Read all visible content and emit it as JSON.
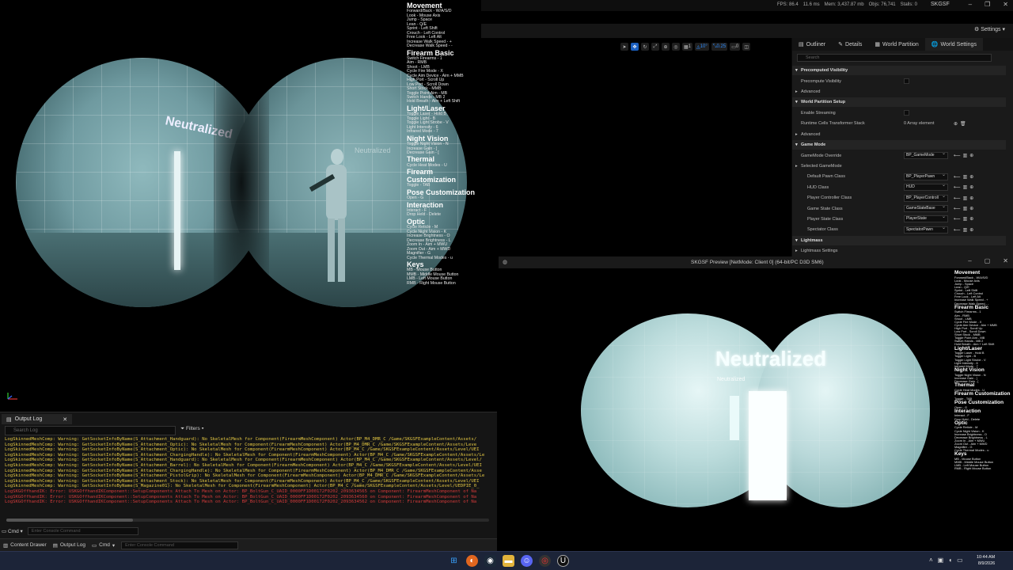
{
  "controls": {
    "sections": [
      {
        "title": "Movement",
        "items": [
          "Forward/Back - W/A/S/D",
          "Look - Mouse Axis",
          "Jump - Space",
          "Lean - Q/E",
          "Sprint - Left Shift",
          "Crouch - Left Control",
          "Free Look - Left Alt",
          "Increase Walk Speed - +",
          "Decrease Walk Speed - -"
        ]
      },
      {
        "title": "Firearm Basic",
        "items": [
          "Switch Firearms - 1",
          "Aim - RMB",
          "Shoot - LMB",
          "Cycle Fire Mode - X",
          "Cycle Aim Device - Aim + MMB",
          "High Port - Scroll Up",
          "Low Port - Scroll Down",
          "Short Stock - MMB",
          "Toggle Point Aim - MB",
          "Switch Hands - MB 2",
          "Hold Breath - Aim + Left Shift"
        ]
      },
      {
        "title": "Light/Laser",
        "items": [
          "Toggle Laser - Hold B",
          "Toggle Light - B",
          "Toggle Light Strobe - V",
          "Light Intensity - 6",
          "Infrared Mode - 7"
        ]
      },
      {
        "title": "Night Vision",
        "items": [
          "Toggle Night Vision - N",
          "Increase Gain - ]",
          "Decrease Gain - ["
        ]
      },
      {
        "title": "Thermal",
        "items": [
          "Cycle Heat Modes - U"
        ]
      },
      {
        "title": "Firearm Customization",
        "items": [
          "Toggle - TAB"
        ]
      },
      {
        "title": "Pose Customization",
        "items": [
          "Open - G"
        ]
      },
      {
        "title": "Interaction",
        "items": [
          "Interact - F",
          "Drop Held - Delete"
        ]
      },
      {
        "title": "Optic",
        "items": [
          "Cycle Reticle - M",
          "Cycle Night Vision - K",
          "Increase Brightness - O",
          "Decrease Brightness - L",
          "Zoom In - Aim + MWU",
          "Zoom Out - Aim + MWD",
          "Magnifier - G",
          "Cycle Thermal Modes - u"
        ]
      },
      {
        "title": "Keys",
        "items": [
          "MB - Mouse Button",
          "MMB - Middle Mouse Button",
          "LMB - Left Mouse Button",
          "RMB - Right Mouse Button"
        ]
      }
    ]
  },
  "game_left": {
    "target_label": "Neutralized",
    "faint_label": "Neutralized"
  },
  "top_bar": {
    "stats": [
      "FPS: 86.4",
      "11.6 ms",
      "Mem: 3,437.87 mb",
      "Objs: 76,741",
      "Stalls: 0"
    ],
    "title": "SKGSF",
    "settings_label": "Settings"
  },
  "viewport_toolbar": {
    "snap_angle": "10°",
    "camera_speed": "0.25",
    "grid": "1",
    "layers": "0"
  },
  "details": {
    "tabs": [
      "Outliner",
      "Details",
      "World Partition",
      "World Settings"
    ],
    "search_placeholder": "Search",
    "rows": [
      {
        "kind": "cat",
        "label": "Precomputed Visibility"
      },
      {
        "kind": "prop",
        "label": "Precompute Visibility",
        "control": "checkbox"
      },
      {
        "kind": "sub",
        "label": "Advanced"
      },
      {
        "kind": "cat",
        "label": "World Partition Setup"
      },
      {
        "kind": "prop",
        "label": "Enable Streaming",
        "control": "checkbox"
      },
      {
        "kind": "prop",
        "label": "Runtime Cells Transformer Stack",
        "value": "0 Array element"
      },
      {
        "kind": "sub",
        "label": "Advanced"
      },
      {
        "kind": "cat",
        "label": "Game Mode"
      },
      {
        "kind": "prop",
        "label": "GameMode Override",
        "value": "BP_GameMode"
      },
      {
        "kind": "sub",
        "label": "Selected GameMode"
      },
      {
        "kind": "prop2",
        "label": "Default Pawn Class",
        "value": "BP_PlayerPawn"
      },
      {
        "kind": "prop2",
        "label": "HUD Class",
        "value": "HUD"
      },
      {
        "kind": "prop2",
        "label": "Player Controller Class",
        "value": "BP_PlayerControll"
      },
      {
        "kind": "prop2",
        "label": "Game State Class",
        "value": "GameStateBase"
      },
      {
        "kind": "prop2",
        "label": "Player State Class",
        "value": "PlayerState"
      },
      {
        "kind": "prop2",
        "label": "Spectator Class",
        "value": "SpectatorPawn"
      },
      {
        "kind": "cat",
        "label": "Lightmass"
      },
      {
        "kind": "sub",
        "label": "Lightmass Settings"
      }
    ]
  },
  "output_log": {
    "tab_label": "Output Log",
    "search_placeholder": "Search Log",
    "filters_label": "Filters",
    "lines": [
      {
        "level": "w",
        "text": "LogSkinnedMeshComp: Warning: GetSocketInfoByName(S_Attachment_Handguard): No SkeletalMesh for Component(FirearmMeshComponent) Actor(BP_M4_DMR_C /Game/SKGSFExampleContent/Assets/"
      },
      {
        "level": "w",
        "text": "LogSkinnedMeshComp: Warning: GetSocketInfoByName(S_Attachment_Optic): No SkeletalMesh for Component(FirearmMeshComponent) Actor(BP_M4_DMR_C /Game/SKGSFExampleContent/Assets/Leve"
      },
      {
        "level": "w",
        "text": "LogSkinnedMeshComp: Warning: GetSocketInfoByName(S_Attachment_Optic): No SkeletalMesh for Component(FirearmMeshComponent) Actor(BP_M4_C /Game/SKGSFExampleContent/Assets/Level/UEI"
      },
      {
        "level": "w",
        "text": "LogSkinnedMeshComp: Warning: GetSocketInfoByName(S_Attachment_ChargingHandle): No SkeletalMesh for Component(FirearmMeshComponent) Actor(BP_M4_C /Game/SKGSFExampleContent/Assets/Le"
      },
      {
        "level": "w",
        "text": "LogSkinnedMeshComp: Warning: GetSocketInfoByName(S_Attachment_Handguard): No SkeletalMesh for Component(FirearmMeshComponent) Actor(BP_M4_C /Game/SKGSFExampleContent/Assets/Level/"
      },
      {
        "level": "w",
        "text": "LogSkinnedMeshComp: Warning: GetSocketInfoByName(S_Attachment_Barrel): No SkeletalMesh for Component(FirearmMeshComponent) Actor(BP_M4_C /Game/SKGSFExampleContent/Assets/Level/UEI"
      },
      {
        "level": "w",
        "text": "LogSkinnedMeshComp: Warning: GetSocketInfoByName(S_Attachment_ChargingHandle): No SkeletalMesh for Component(FirearmMeshComponent) Actor(BP_M4_DMR_C /Game/SKGSFExampleContent/Asse"
      },
      {
        "level": "w",
        "text": "LogSkinnedMeshComp: Warning: GetSocketInfoByName(S_Attachment_PistolGrip): No SkeletalMesh for Component(FirearmMeshComponent) Actor(BP_M4_DMR_C /Game/SKGSFExampleContent/Assets/Le"
      },
      {
        "level": "w",
        "text": "LogSkinnedMeshComp: Warning: GetSocketInfoByName(S_Attachment_Stock): No SkeletalMesh for Component(FirearmMeshComponent) Actor(BP_M4_C /Game/SKGSFExampleContent/Assets/Level/UEI"
      },
      {
        "level": "w",
        "text": "LogSkinnedMeshComp: Warning: GetSocketInfoByName(S_Magazine01): No SkeletalMesh for Component(FirearmMeshComponent) Actor(BP_M4_C /Game/SKGSFExampleContent/Assets/Level/UEDPIE_0_"
      },
      {
        "level": "e",
        "text": "LogSKGOffhandIK: Error: USKGOffhandIKComponent::SetupComponents Attach To Mesh on Actor: BP_BoltGun_C_UAID_0000FF1D00172F0202_2093634565 on Component: FirearmMeshComponent of Na"
      },
      {
        "level": "e",
        "text": "LogSKGOffhandIK: Error: USKGOffhandIKComponent::SetupComponents Attach To Mesh on Actor: BP_BoltGun_C_UAID_0000FF1D00172F0202_2093634560 on Component: FirearmMeshComponent of Na"
      },
      {
        "level": "e",
        "text": "LogSKGOffhandIK: Error: USKGOffhandIKComponent::SetupComponents Attach To Mesh on Actor: BP_BoltGun_C_UAID_0000FF1D00172F0202_2093634562 on Component: FirearmMeshComponent of Na"
      }
    ],
    "cmd_label": "Cmd",
    "cmd_placeholder": "Enter Console Command"
  },
  "bottom_bar": {
    "content_drawer": "Content Drawer",
    "output_log": "Output Log",
    "cmd_label": "Cmd",
    "cmd_placeholder": "Enter Console Command"
  },
  "preview": {
    "title": "SKGSF Preview [NetMode: Client 0]  (64-bit/PC D3D SM6)",
    "big_label": "Neutralized",
    "small_label": "Neutralized"
  },
  "taskbar": {
    "time": "10:44 AM",
    "date": "8/9/2026"
  },
  "colors": {
    "warning": "#e1c542",
    "error": "#d33a3a",
    "accent": "#1b5fbf"
  }
}
